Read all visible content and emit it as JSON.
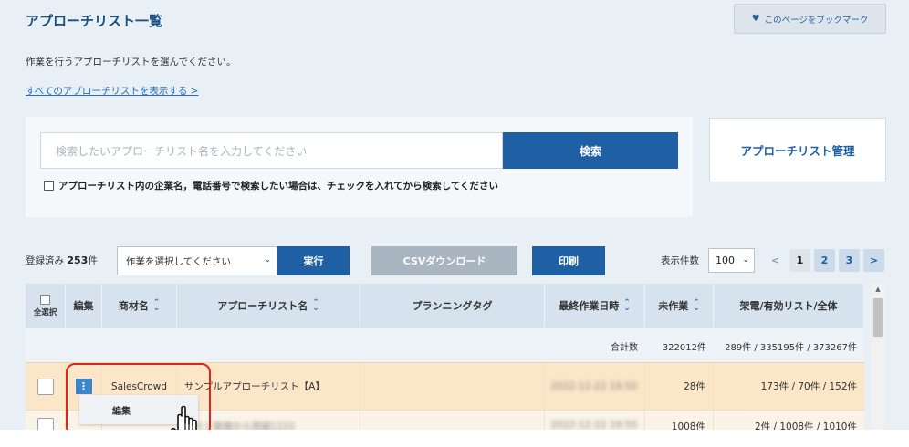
{
  "page": {
    "title": "アプローチリスト一覧",
    "bookmark_label": "このページをブックマーク",
    "instruction": "作業を行うアプローチリストを選んでください。",
    "show_all_link": "すべてのアプローチリストを表示する >"
  },
  "search": {
    "placeholder": "検索したいアプローチリスト名を入力してください",
    "button_label": "検索",
    "checkbox_label": "アプローチリスト内の企業名，電話番号で検索したい場合は、チェックを入れてから検索してください",
    "manage_button_label": "アプローチリスト管理"
  },
  "toolbar": {
    "registered_prefix": "登録済み",
    "registered_count": "253",
    "registered_suffix": "件",
    "action_select": "作業を選択してください",
    "execute_label": "実行",
    "csv_label": "CSVダウンロード",
    "print_label": "印刷",
    "per_page_label": "表示件数",
    "per_page_value": "100"
  },
  "pagination": {
    "prev": "<",
    "pages": [
      "1",
      "2",
      "3"
    ],
    "next": ">",
    "current": "1"
  },
  "table": {
    "headers": {
      "select_all": "全選択",
      "edit": "編集",
      "product": "商材名",
      "list_name": "アプローチリスト名",
      "planning_tag": "プランニングタグ",
      "last_work": "最終作業日時",
      "unworked": "未作業",
      "calls": "架電/有効リスト/全体"
    },
    "total_row": {
      "label": "合計数",
      "unworked": "322012件",
      "calls": "289件 / 335195件 / 373267件"
    },
    "rows": [
      {
        "product": "SalesCrowd",
        "list_name": "サンプルアプローチリスト【A】",
        "last_work": "2022-12-22 19:50",
        "unworked": "28件",
        "calls": "173件 / 70件 / 152件"
      },
      {
        "product": "",
        "list_name": "テスト管理から登録1222",
        "last_work": "2022-12-22 19:50",
        "unworked": "1008件",
        "calls": "2件 / 1008件 / 1010件"
      }
    ]
  },
  "row_menu": {
    "edit_label": "編集"
  },
  "colors": {
    "primary": "#1f5fa3",
    "background": "#e8eff5",
    "table_header": "#d6e2ed",
    "selected_row": "#fbe6c8",
    "highlight": "#e2231a"
  }
}
